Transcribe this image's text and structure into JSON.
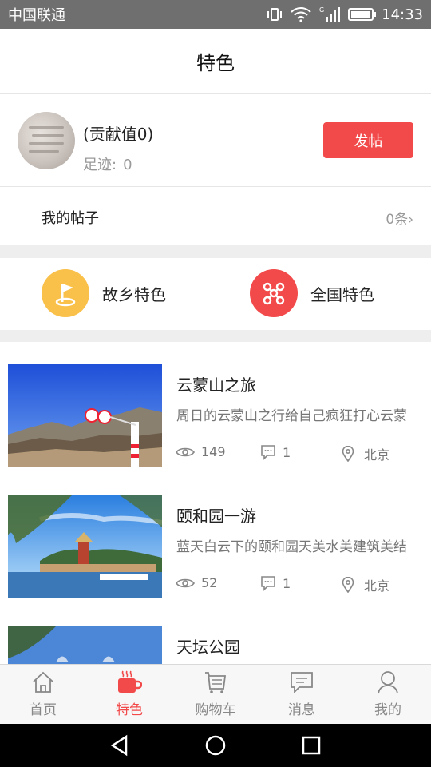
{
  "status_bar": {
    "carrier": "中国联通",
    "time": "14:33"
  },
  "header": {
    "title": "特色"
  },
  "profile": {
    "contribution": "(贡献值0)",
    "footprint_label": "足迹:",
    "footprint_value": "0",
    "post_button": "发帖"
  },
  "my_posts": {
    "label": "我的帖子",
    "count": "0条›"
  },
  "categories": [
    {
      "label": "故乡特色",
      "icon": "flag-icon",
      "color": "#f9c04a"
    },
    {
      "label": "全国特色",
      "icon": "network-icon",
      "color": "#f24a4a"
    }
  ],
  "posts": [
    {
      "title": "云蒙山之旅",
      "desc": "周日的云蒙山之行给自己疯狂打心云蒙",
      "views": "149",
      "comments": "1",
      "location": "北京"
    },
    {
      "title": "颐和园一游",
      "desc": "蓝天白云下的颐和园天美水美建筑美结",
      "views": "52",
      "comments": "1",
      "location": "北京"
    },
    {
      "title": "天坛公园",
      "desc": "",
      "views": "",
      "comments": "",
      "location": ""
    }
  ],
  "tabs": [
    {
      "label": "首页",
      "icon": "home-icon",
      "active": false
    },
    {
      "label": "特色",
      "icon": "coffee-cup-icon",
      "active": true
    },
    {
      "label": "购物车",
      "icon": "cart-icon",
      "active": false
    },
    {
      "label": "消息",
      "icon": "message-icon",
      "active": false
    },
    {
      "label": "我的",
      "icon": "user-icon",
      "active": false
    }
  ],
  "colors": {
    "accent": "#f24a4a",
    "yellow": "#f9c04a",
    "muted": "#999999"
  }
}
